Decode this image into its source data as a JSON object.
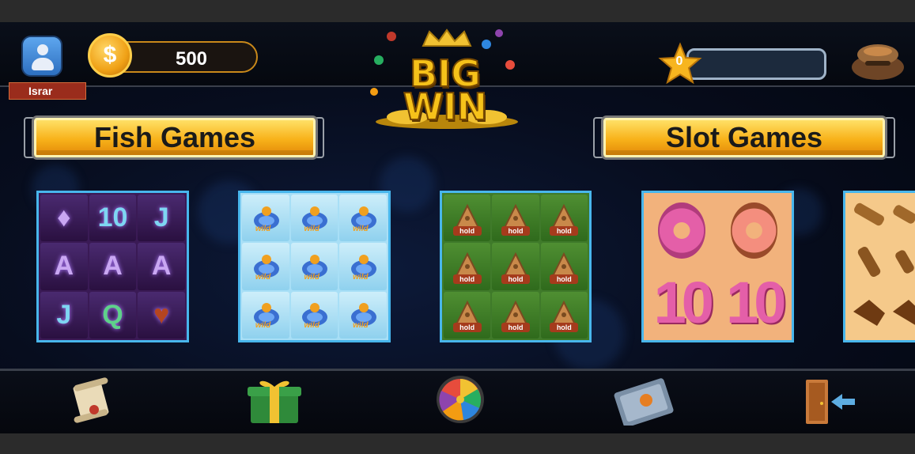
{
  "player": {
    "name": "Israr",
    "coins": "500",
    "stars": "0"
  },
  "logo": {
    "line1": "BIG",
    "line2": "WIN"
  },
  "sections": {
    "fish_label": "Fish Games",
    "slot_label": "Slot Games"
  },
  "games": {
    "card1_symbols": [
      "♦",
      "10",
      "J",
      "A",
      "A",
      "A",
      "J",
      "Q",
      "♥"
    ],
    "card2_symbol": "wild",
    "card3_symbol": "hold",
    "card4_symbol": "10"
  },
  "colors": {
    "banner_yellow": "#f8b21a",
    "card_border": "#48b6ec",
    "name_tag": "#9a2c1c"
  },
  "icons": {
    "bottom": [
      "scroll-icon",
      "gift-icon",
      "wheel-icon",
      "book-icon",
      "exit-icon"
    ]
  }
}
